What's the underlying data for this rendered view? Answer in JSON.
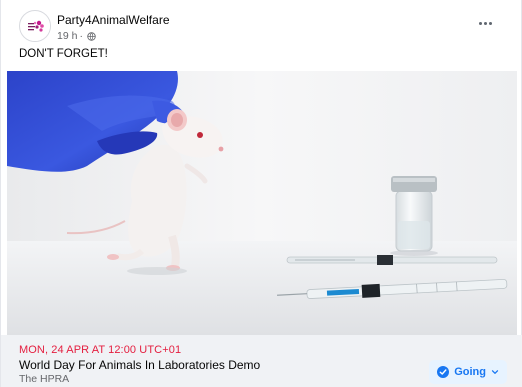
{
  "post": {
    "page_name": "Party4AnimalWelfare",
    "time": "19 h",
    "separator": "·",
    "caption": "DON'T FORGET!"
  },
  "event": {
    "date": "MON, 24 APR AT 12:00 UTC+01",
    "title": "World Day For Animals In Laboratories Demo",
    "host": "The HPRA",
    "going_label": "Going"
  },
  "icons": {
    "more": "more-options-icon",
    "privacy": "globe-icon",
    "going": "check-circle-icon",
    "dropdown": "chevron-down-icon"
  },
  "colors": {
    "accent": "#1877f2",
    "date_red": "#e41e3f",
    "glove_blue": "#3350d8"
  }
}
